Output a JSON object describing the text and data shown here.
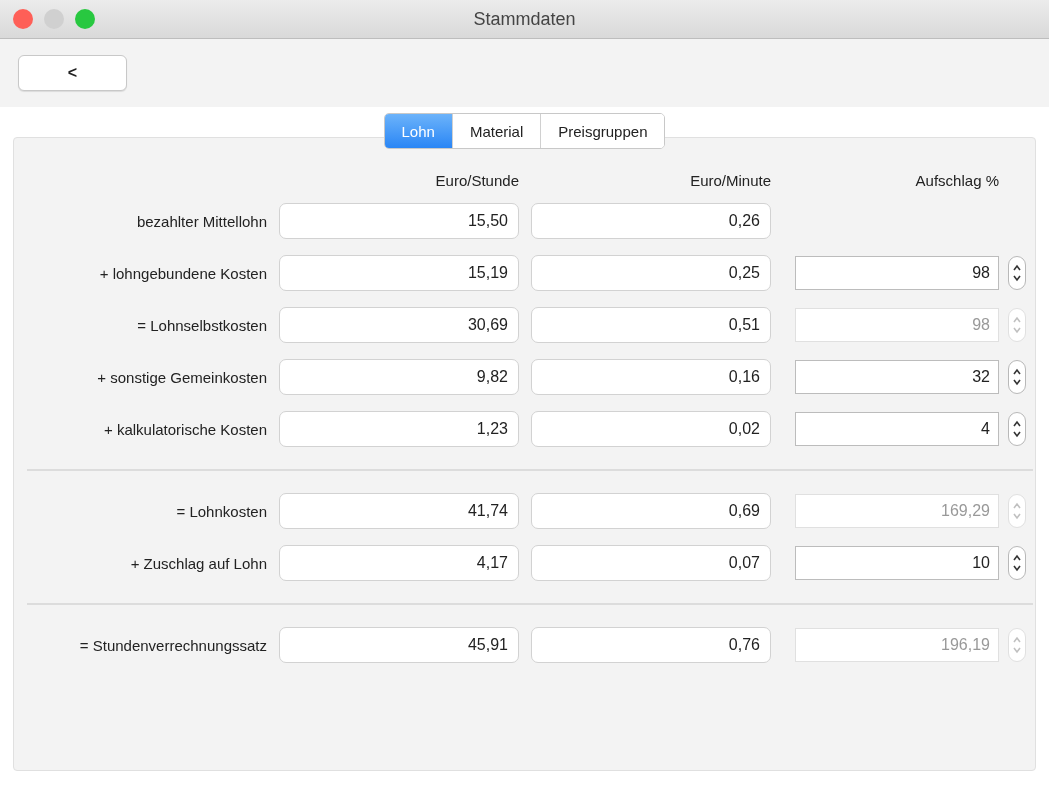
{
  "window": {
    "title": "Stammdaten"
  },
  "toolbar": {
    "back_button": "<"
  },
  "tabs": [
    {
      "label": "Lohn",
      "selected": true
    },
    {
      "label": "Material",
      "selected": false
    },
    {
      "label": "Preisgruppen",
      "selected": false
    }
  ],
  "columns": [
    "Euro/Stunde",
    "Euro/Minute",
    "Aufschlag %"
  ],
  "sections": [
    [
      {
        "label": "bezahlter Mittellohn",
        "per_hour": "15,50",
        "per_minute": "0,26"
      },
      {
        "label": "+ lohngebundene Kosten",
        "per_hour": "15,19",
        "per_minute": "0,25",
        "surcharge": "98",
        "disabled": false
      },
      {
        "label": "= Lohnselbstkosten",
        "per_hour": "30,69",
        "per_minute": "0,51",
        "surcharge": "98",
        "disabled": true
      },
      {
        "label": "+ sonstige Gemeinkosten",
        "per_hour": "9,82",
        "per_minute": "0,16",
        "surcharge": "32",
        "disabled": false
      },
      {
        "label": "+ kalkulatorische Kosten",
        "per_hour": "1,23",
        "per_minute": "0,02",
        "surcharge": "4",
        "disabled": false
      }
    ],
    [
      {
        "label": "= Lohnkosten",
        "per_hour": "41,74",
        "per_minute": "0,69",
        "surcharge": "169,29",
        "disabled": true
      },
      {
        "label": "+ Zuschlag auf Lohn",
        "per_hour": "4,17",
        "per_minute": "0,07",
        "surcharge": "10",
        "disabled": false
      }
    ],
    [
      {
        "label": "= Stundenverrechnungssatz",
        "per_hour": "45,91",
        "per_minute": "0,76",
        "surcharge": "196,19",
        "disabled": true
      }
    ]
  ]
}
